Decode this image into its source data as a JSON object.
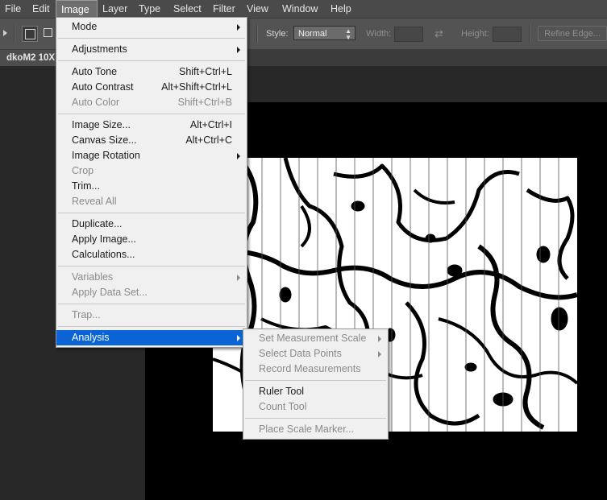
{
  "menubar": [
    "File",
    "Edit",
    "Image",
    "Layer",
    "Type",
    "Select",
    "Filter",
    "View",
    "Window",
    "Help"
  ],
  "options_bar": {
    "style_label": "Style:",
    "style_value": "Normal",
    "width_label": "Width:",
    "height_label": "Height:",
    "refine_edge": "Refine Edge..."
  },
  "document": {
    "tab_title": "dkoM2 10X"
  },
  "image_menu": {
    "items": [
      {
        "label": "Mode",
        "shortcut": "",
        "submenu": true,
        "disabled": false
      },
      {
        "sep": true
      },
      {
        "label": "Adjustments",
        "shortcut": "",
        "submenu": true,
        "disabled": false
      },
      {
        "sep": true
      },
      {
        "label": "Auto Tone",
        "shortcut": "Shift+Ctrl+L",
        "submenu": false,
        "disabled": false
      },
      {
        "label": "Auto Contrast",
        "shortcut": "Alt+Shift+Ctrl+L",
        "submenu": false,
        "disabled": false
      },
      {
        "label": "Auto Color",
        "shortcut": "Shift+Ctrl+B",
        "submenu": false,
        "disabled": true
      },
      {
        "sep": true
      },
      {
        "label": "Image Size...",
        "shortcut": "Alt+Ctrl+I",
        "submenu": false,
        "disabled": false
      },
      {
        "label": "Canvas Size...",
        "shortcut": "Alt+Ctrl+C",
        "submenu": false,
        "disabled": false
      },
      {
        "label": "Image Rotation",
        "shortcut": "",
        "submenu": true,
        "disabled": false
      },
      {
        "label": "Crop",
        "shortcut": "",
        "submenu": false,
        "disabled": true
      },
      {
        "label": "Trim...",
        "shortcut": "",
        "submenu": false,
        "disabled": false
      },
      {
        "label": "Reveal All",
        "shortcut": "",
        "submenu": false,
        "disabled": true
      },
      {
        "sep": true
      },
      {
        "label": "Duplicate...",
        "shortcut": "",
        "submenu": false,
        "disabled": false
      },
      {
        "label": "Apply Image...",
        "shortcut": "",
        "submenu": false,
        "disabled": false
      },
      {
        "label": "Calculations...",
        "shortcut": "",
        "submenu": false,
        "disabled": false
      },
      {
        "sep": true
      },
      {
        "label": "Variables",
        "shortcut": "",
        "submenu": true,
        "disabled": true
      },
      {
        "label": "Apply Data Set...",
        "shortcut": "",
        "submenu": false,
        "disabled": true
      },
      {
        "sep": true
      },
      {
        "label": "Trap...",
        "shortcut": "",
        "submenu": false,
        "disabled": true
      },
      {
        "sep": true
      },
      {
        "label": "Analysis",
        "shortcut": "",
        "submenu": true,
        "disabled": false,
        "highlight": true
      }
    ]
  },
  "analysis_menu": {
    "items": [
      {
        "label": "Set Measurement Scale",
        "submenu": true,
        "disabled": true
      },
      {
        "label": "Select Data Points",
        "submenu": true,
        "disabled": true
      },
      {
        "label": "Record Measurements",
        "submenu": false,
        "disabled": true
      },
      {
        "sep": true
      },
      {
        "label": "Ruler Tool",
        "submenu": false,
        "disabled": false
      },
      {
        "label": "Count Tool",
        "submenu": false,
        "disabled": true
      },
      {
        "sep": true
      },
      {
        "label": "Place Scale Marker...",
        "submenu": false,
        "disabled": true
      }
    ]
  },
  "colors": {
    "highlight": "#0a64d6",
    "menu_bg": "#f0f0f0",
    "app_bg": "#282828",
    "canvas_bg": "#000000"
  }
}
